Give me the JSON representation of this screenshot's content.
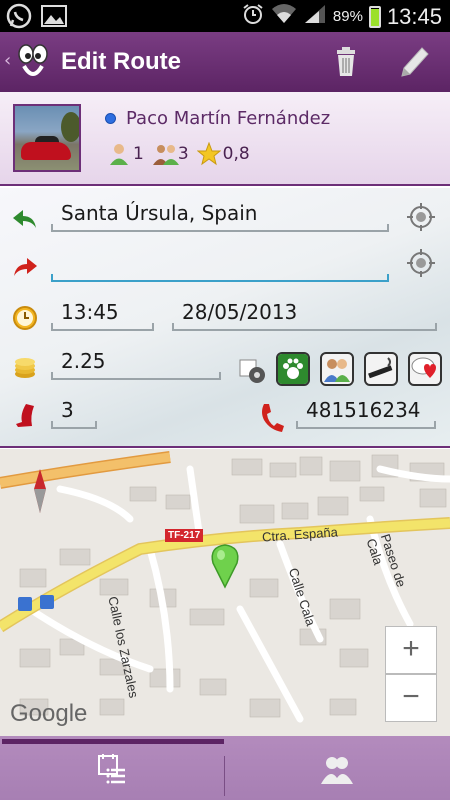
{
  "status_bar": {
    "battery_pct": "89%",
    "time": "13:45",
    "icons": [
      "whatsapp-icon",
      "gallery-icon",
      "alarm-icon",
      "wifi-icon",
      "signal-icon",
      "battery-icon"
    ]
  },
  "action_bar": {
    "title": "Edit Route",
    "actions": [
      "trash-icon",
      "pencil-icon"
    ]
  },
  "profile": {
    "name": "Paco Martín Fernández",
    "status_color": "#2e6ee0",
    "stats": {
      "driver_count": "1",
      "passenger_count": "3",
      "rating": "0,8"
    }
  },
  "route_form": {
    "origin": "Santa Úrsula, Spain",
    "destination": "",
    "time": "13:45",
    "date": "28/05/2013",
    "price": "2.25",
    "seats": "3",
    "phone": "481516234",
    "preferences": [
      "pets-icon",
      "people-icon",
      "smoking-icon",
      "chat-heart-icon"
    ]
  },
  "map": {
    "road_labels": {
      "ctra": "Ctra. España",
      "calle_zarzales": "Calle los Zarzales",
      "calle_cala": "Calle Cala",
      "paseo_cala": "Paseo de Cala",
      "route_badge": "TF-217"
    },
    "attribution": "Google",
    "zoom_in": "+",
    "zoom_out": "−"
  },
  "bottom_nav": {
    "tabs": [
      "calendar-list-icon",
      "group-icon"
    ],
    "active_tab": 0
  },
  "colors": {
    "brand_purple": "#5c2464",
    "accent_blue": "#3ba0c9",
    "map_route": "#f3e46a"
  }
}
